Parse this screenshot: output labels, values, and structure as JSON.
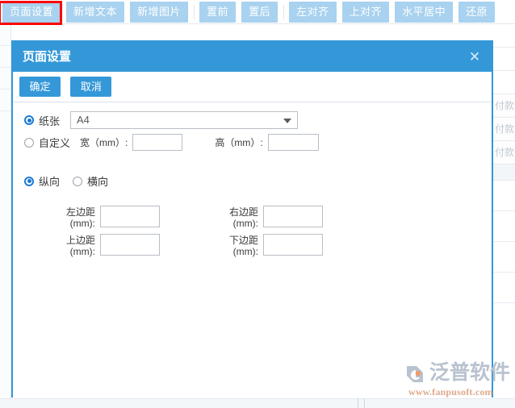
{
  "toolbar": {
    "buttons": [
      {
        "label": "页面设置",
        "highlighted": true
      },
      {
        "label": "新增文本",
        "highlighted": false
      },
      {
        "label": "新增图片",
        "highlighted": false
      },
      {
        "label": "置前",
        "highlighted": false
      },
      {
        "label": "置后",
        "highlighted": false
      },
      {
        "label": "左对齐",
        "highlighted": false
      },
      {
        "label": "上对齐",
        "highlighted": false
      },
      {
        "label": "水平居中",
        "highlighted": false
      },
      {
        "label": "还原",
        "highlighted": false
      }
    ]
  },
  "dialog": {
    "title": "页面设置",
    "close_icon": "close-icon",
    "confirm_label": "确定",
    "cancel_label": "取消",
    "paper": {
      "radio_label": "纸张",
      "selected": true,
      "size_value": "A4",
      "size_options": [
        "A4"
      ],
      "dropdown_icon": "chevron-down-icon"
    },
    "custom": {
      "radio_label": "自定义",
      "selected": false,
      "width_label": "宽（mm）:",
      "width_value": "",
      "height_label": "高（mm）:",
      "height_value": ""
    },
    "orientation": {
      "portrait_label": "纵向",
      "portrait_selected": true,
      "landscape_label": "横向",
      "landscape_selected": false
    },
    "margins": {
      "left_label": "左边距\n(mm):",
      "left_value": "",
      "right_label": "右边距\n(mm):",
      "right_value": "",
      "top_label": "上边距\n(mm):",
      "top_value": "",
      "bottom_label": "下边距\n(mm):",
      "bottom_value": ""
    }
  },
  "background": {
    "right_rows": [
      "付款",
      "付款",
      "付款"
    ]
  },
  "watermark": {
    "brand": "泛普软件",
    "url": "www.fanpusoft.com"
  },
  "colors": {
    "toolbar_button": "#a8d2ef",
    "dialog_accent": "#3498d8",
    "annotation": "#ff0000",
    "radio_checked": "#1a7ad4"
  }
}
